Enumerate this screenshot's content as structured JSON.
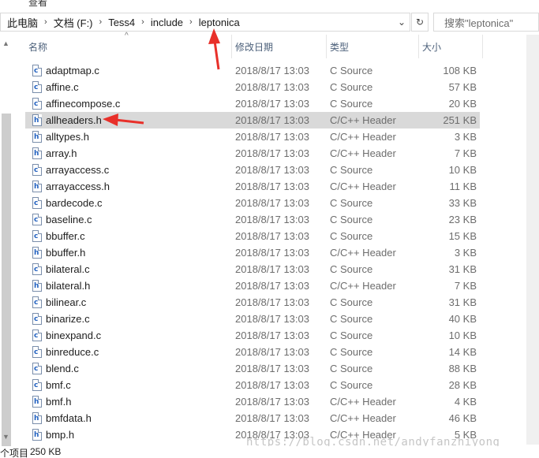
{
  "ribbon": {
    "left_text": "",
    "right_text": "查看"
  },
  "address": {
    "crumbs": [
      "此电脑",
      "文档 (F:)",
      "Tess4",
      "include",
      "leptonica"
    ],
    "refresh_glyph": "↻",
    "dropdown_glyph": "⌄"
  },
  "search": {
    "placeholder": "搜索\"leptonica\""
  },
  "columns": {
    "name": "名称",
    "date": "修改日期",
    "type": "类型",
    "size": "大小"
  },
  "files": [
    {
      "name": "adaptmap.c",
      "date": "2018/8/17 13:03",
      "type": "C Source",
      "size": "108 KB",
      "ext": "c"
    },
    {
      "name": "affine.c",
      "date": "2018/8/17 13:03",
      "type": "C Source",
      "size": "57 KB",
      "ext": "c"
    },
    {
      "name": "affinecompose.c",
      "date": "2018/8/17 13:03",
      "type": "C Source",
      "size": "20 KB",
      "ext": "c"
    },
    {
      "name": "allheaders.h",
      "date": "2018/8/17 13:03",
      "type": "C/C++ Header",
      "size": "251 KB",
      "ext": "h",
      "selected": true
    },
    {
      "name": "alltypes.h",
      "date": "2018/8/17 13:03",
      "type": "C/C++ Header",
      "size": "3 KB",
      "ext": "h"
    },
    {
      "name": "array.h",
      "date": "2018/8/17 13:03",
      "type": "C/C++ Header",
      "size": "7 KB",
      "ext": "h"
    },
    {
      "name": "arrayaccess.c",
      "date": "2018/8/17 13:03",
      "type": "C Source",
      "size": "10 KB",
      "ext": "c"
    },
    {
      "name": "arrayaccess.h",
      "date": "2018/8/17 13:03",
      "type": "C/C++ Header",
      "size": "11 KB",
      "ext": "h"
    },
    {
      "name": "bardecode.c",
      "date": "2018/8/17 13:03",
      "type": "C Source",
      "size": "33 KB",
      "ext": "c"
    },
    {
      "name": "baseline.c",
      "date": "2018/8/17 13:03",
      "type": "C Source",
      "size": "23 KB",
      "ext": "c"
    },
    {
      "name": "bbuffer.c",
      "date": "2018/8/17 13:03",
      "type": "C Source",
      "size": "15 KB",
      "ext": "c"
    },
    {
      "name": "bbuffer.h",
      "date": "2018/8/17 13:03",
      "type": "C/C++ Header",
      "size": "3 KB",
      "ext": "h"
    },
    {
      "name": "bilateral.c",
      "date": "2018/8/17 13:03",
      "type": "C Source",
      "size": "31 KB",
      "ext": "c"
    },
    {
      "name": "bilateral.h",
      "date": "2018/8/17 13:03",
      "type": "C/C++ Header",
      "size": "7 KB",
      "ext": "h"
    },
    {
      "name": "bilinear.c",
      "date": "2018/8/17 13:03",
      "type": "C Source",
      "size": "31 KB",
      "ext": "c"
    },
    {
      "name": "binarize.c",
      "date": "2018/8/17 13:03",
      "type": "C Source",
      "size": "40 KB",
      "ext": "c"
    },
    {
      "name": "binexpand.c",
      "date": "2018/8/17 13:03",
      "type": "C Source",
      "size": "10 KB",
      "ext": "c"
    },
    {
      "name": "binreduce.c",
      "date": "2018/8/17 13:03",
      "type": "C Source",
      "size": "14 KB",
      "ext": "c"
    },
    {
      "name": "blend.c",
      "date": "2018/8/17 13:03",
      "type": "C Source",
      "size": "88 KB",
      "ext": "c"
    },
    {
      "name": "bmf.c",
      "date": "2018/8/17 13:03",
      "type": "C Source",
      "size": "28 KB",
      "ext": "c"
    },
    {
      "name": "bmf.h",
      "date": "2018/8/17 13:03",
      "type": "C/C++ Header",
      "size": "4 KB",
      "ext": "h"
    },
    {
      "name": "bmfdata.h",
      "date": "2018/8/17 13:03",
      "type": "C/C++ Header",
      "size": "46 KB",
      "ext": "h"
    },
    {
      "name": "bmp.h",
      "date": "2018/8/17 13:03",
      "type": "C/C++ Header",
      "size": "5 KB",
      "ext": "h"
    }
  ],
  "status": {
    "item_suffix": "个项目",
    "size": "250 KB"
  },
  "watermark": "https://blog.csdn.net/andyfanzhiyong",
  "colors": {
    "selection": "#d9d9d9",
    "annotation_arrow": "#e8302a",
    "header_text": "#4c607a"
  }
}
